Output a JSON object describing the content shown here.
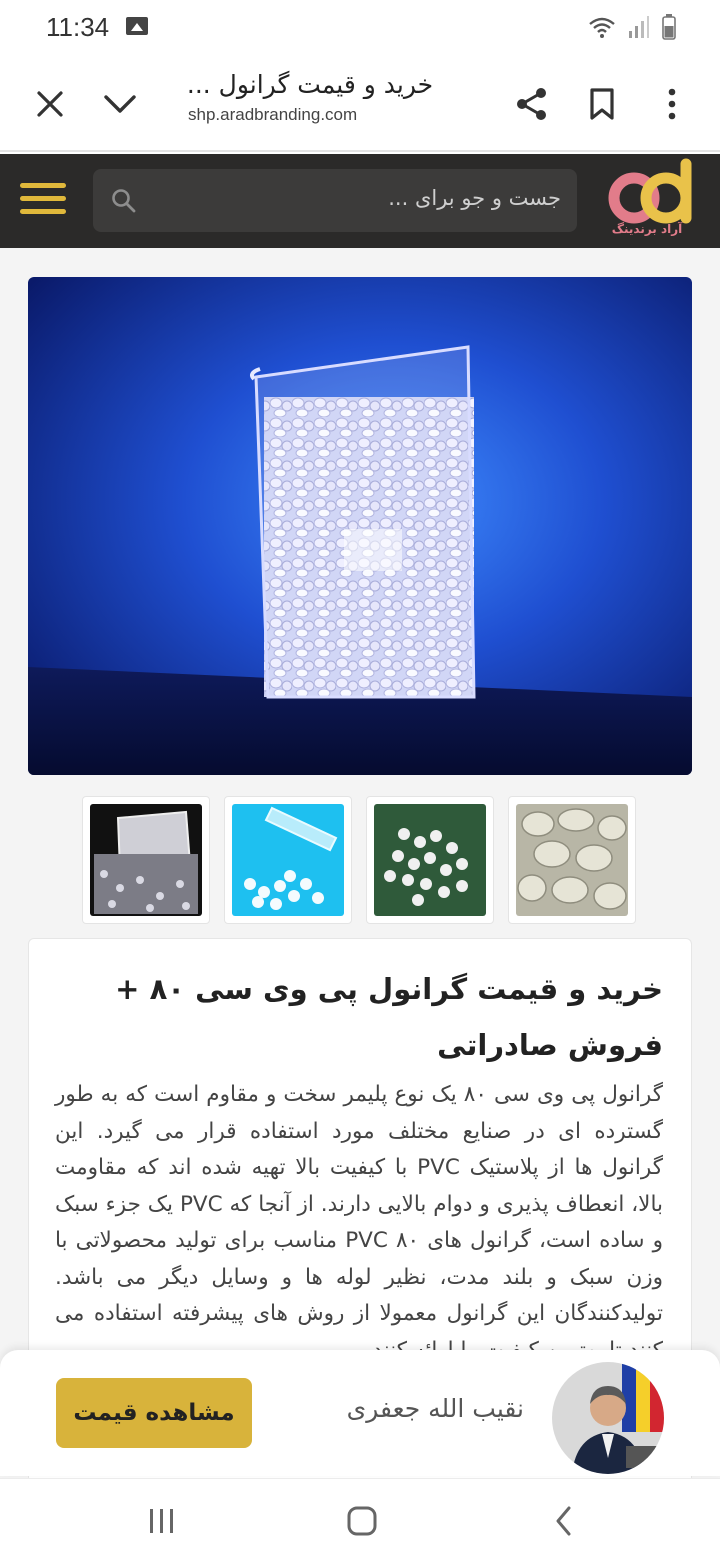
{
  "status_bar": {
    "time": "11:34",
    "icons": [
      "image-icon",
      "wifi-icon",
      "signal-icon",
      "battery-icon"
    ]
  },
  "browser": {
    "page_title": "خرید و قیمت گرانول ...",
    "url": "shp.aradbranding.com",
    "icons": [
      "close-icon",
      "chevron-down-icon",
      "share-icon",
      "bookmark-icon",
      "more-vert-icon"
    ]
  },
  "site_header": {
    "search_placeholder": "جست و جو برای ...",
    "brand_name": "آراد برندینگ",
    "accent_color": "#e0b83b",
    "header_color": "#2b2a29"
  },
  "product": {
    "title": "خرید و قیمت گرانول پی وی سی ۸۰ + فروش صادراتی",
    "description": "گرانول پی وی سی ۸۰ یک نوع پلیمر سخت و مقاوم است که به طور گسترده ای در صنایع مختلف مورد استفاده قرار می گیرد. این گرانول ها از پلاستیک PVC با کیفیت بالا تهیه شده اند که مقاومت بالا، انعطاف پذیری و دوام بالایی دارند. از آنجا که PVC یک جزء سبک و ساده است، گرانول های PVC ۸۰ مناسب برای تولید محصولاتی با وزن سبک و بلند مدت، نظیر لوله ها و وسایل دیگر می باشد. تولیدکنندگان این گرانول معمولا از روش های پیشرفته استفاده می کنند تا بهترین کیفیت را ارائه کنند.",
    "thumbnails": [
      "thumbnail-clear-granules-box",
      "thumbnail-granules-test-tube",
      "thumbnail-white-granules",
      "thumbnail-large-pellets"
    ]
  },
  "seller": {
    "name": "نقیب الله جعفری",
    "button_label": "مشاهده قیمت",
    "button_color": "#d8b33b"
  },
  "nav_bar": {
    "icons": [
      "recent-apps-icon",
      "home-icon",
      "back-icon"
    ]
  }
}
